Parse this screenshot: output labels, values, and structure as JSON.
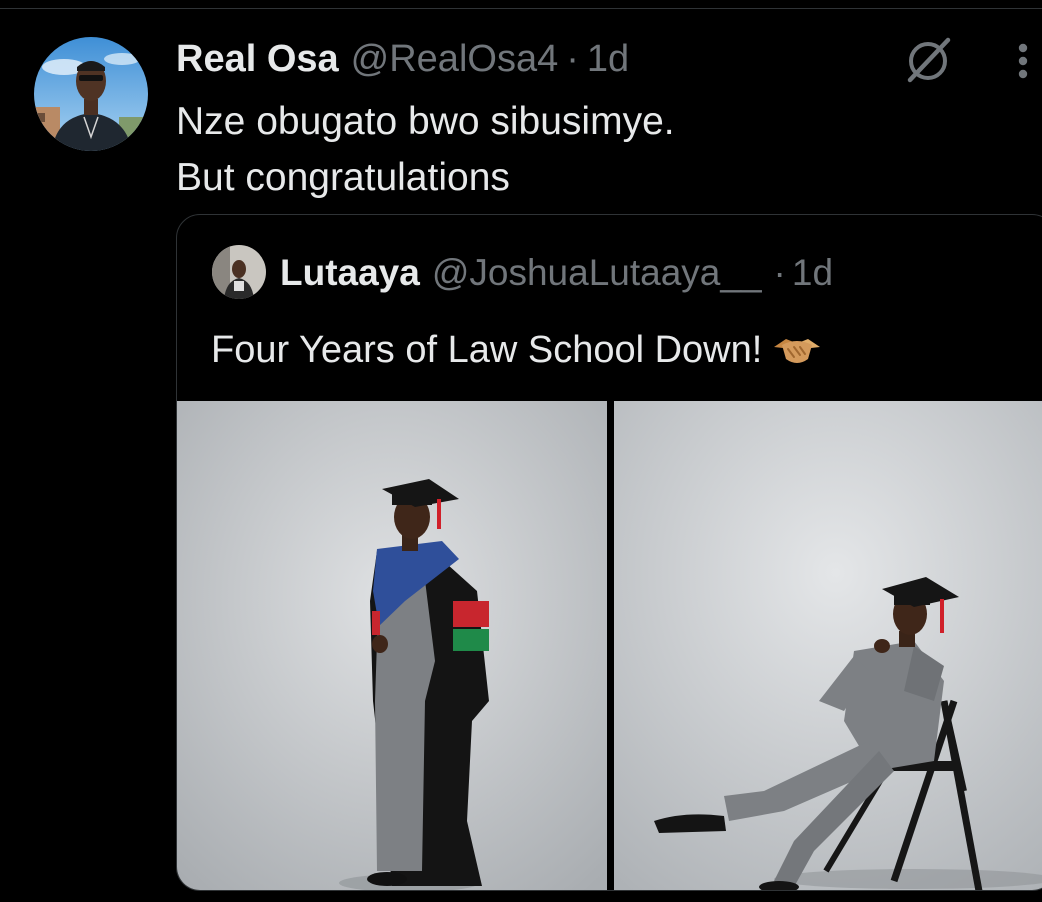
{
  "tweet": {
    "display_name": "Real Osa",
    "handle": "@RealOsa4",
    "separator": "·",
    "time": "1d",
    "text_line1": "Nze obugato bwo sibusimye.",
    "text_line2": "But congratulations"
  },
  "quoted_tweet": {
    "display_name": "Lutaaya",
    "handle": "@JoshuaLutaaya__",
    "separator": "·",
    "time": "1d",
    "text": "Four Years of Law School Down!",
    "emoji_icon": "handshake-icon",
    "photos": [
      "graduate-standing-photo",
      "graduate-seated-photo"
    ]
  },
  "icons": {
    "grok": "grok-icon",
    "more": "more-options-icon"
  },
  "colors": {
    "background": "#000000",
    "text": "#e7e9ea",
    "secondary_text": "#71767b",
    "border": "#2f3336"
  }
}
